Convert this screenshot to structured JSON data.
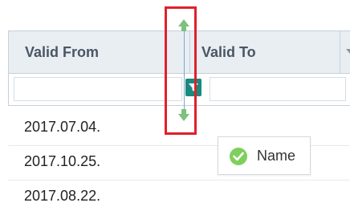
{
  "table": {
    "columns": [
      {
        "label": "Valid From"
      },
      {
        "label": "Valid To"
      }
    ],
    "rows": [
      {
        "valid_from": "2017.07.04."
      },
      {
        "valid_from": "2017.10.25."
      },
      {
        "valid_from": "2017.08.22."
      }
    ]
  },
  "tooltip": {
    "label": "Name",
    "icon": "check-circle-icon"
  },
  "colors": {
    "highlight": "#e0202a",
    "resize_arrows": "#7ec07e",
    "filter_button": "#1a8a7f",
    "check": "#7ed05d"
  }
}
